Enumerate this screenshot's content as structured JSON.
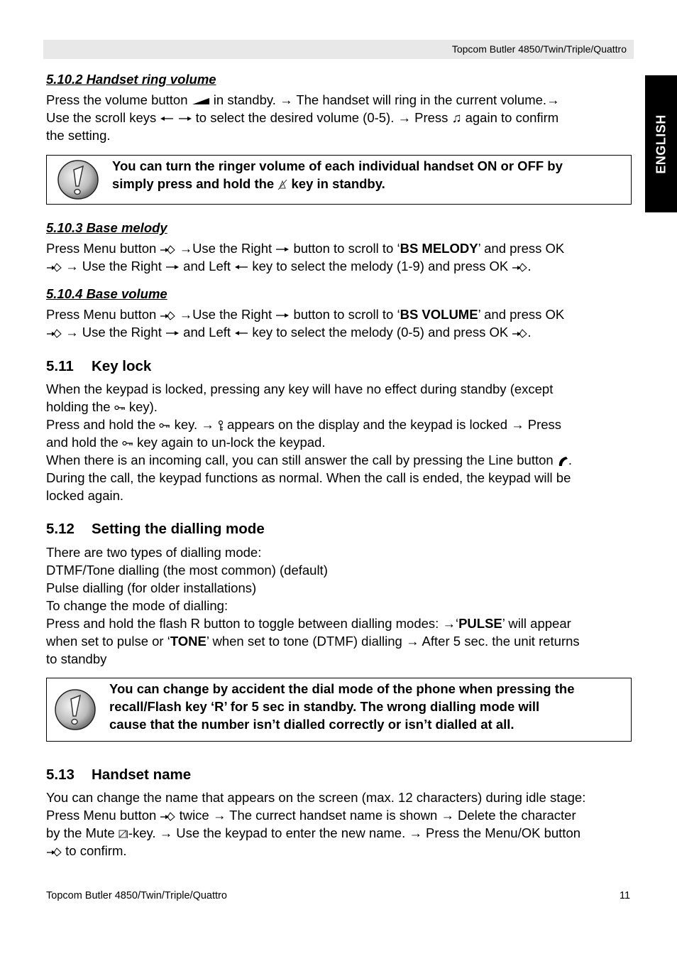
{
  "header": {
    "title": "Topcom Butler 4850/Twin/Triple/Quattro"
  },
  "language_tab": {
    "label": "ENGLISH"
  },
  "sections": {
    "ring_volume": {
      "heading": "5.10.2 Handset ring volume",
      "lines": [
        [
          "Press the volume button ",
          " in standby. ",
          "  The handset will ring in the current volume.",
          ""
        ],
        [
          "Use the scroll keys ",
          " ",
          " to select the desired volume (0-5). ",
          " Press ",
          " again to confirm"
        ],
        [
          "the setting."
        ]
      ],
      "note": {
        "line1": "You can turn the ringer volume of each individual handset ON or OFF by",
        "line2_a": "simply press and hold the ",
        "line2_b": " key in standby."
      }
    },
    "base_melody": {
      "heading": "5.10.3 Base melody",
      "l1_a": "Press Menu button ",
      "l1_b": "Use the Right ",
      "l1_c": " button to scroll to ‘",
      "l1_bold": "BS MELODY",
      "l1_d": "’ and press OK",
      "l2_a": "  Use the Right ",
      "l2_b": " and Left ",
      "l2_c": " key to select the melody (1-9) and press OK ",
      "l2_d": "."
    },
    "base_volume": {
      "heading": "5.10.4 Base volume",
      "l1_a": "Press Menu button ",
      "l1_b": "Use the Right ",
      "l1_c": " button to scroll to ‘",
      "l1_bold": "BS VOLUME",
      "l1_d": "’ and press OK",
      "l2_a": "  Use the Right ",
      "l2_b": " and Left ",
      "l2_c": " key to select the melody (0-5) and press OK ",
      "l2_d": "."
    },
    "key_lock": {
      "number": "5.11",
      "title": "Key lock",
      "l1": "When the keypad is locked, pressing any key will have no effect during standby (except",
      "l2_a": "holding the ",
      "l2_b": " key).",
      "l3_a": "Press and hold the ",
      "l3_b": " key. ",
      "l3_c": " appears on the display and the keypad is locked  ",
      "l3_d": " Press",
      "l4_a": "and hold the ",
      "l4_b": " key again to un-lock the keypad.",
      "l5_a": "When there is an incoming call, you can still answer the call by pressing the Line button ",
      "l5_b": ".",
      "l6": "During the call, the keypad functions as normal. When the call is ended, the keypad will be",
      "l7": "locked again."
    },
    "dialling_mode": {
      "number": "5.12",
      "title": "Setting the dialling mode",
      "l1": "There are two types of dialling mode:",
      "l2": "DTMF/Tone dialling (the most common) (default)",
      "l3": "Pulse dialling (for older installations)",
      "l4": "To change the mode of dialling:",
      "l5_a": "Press and hold the flash R button to toggle between dialling modes: ",
      "l5_b": "‘",
      "l5_bold": "PULSE",
      "l5_c": "’ will appear",
      "l6_a": "when set to pulse or ‘",
      "l6_bold": "TONE",
      "l6_b": "’ when set to tone (DTMF) dialling ",
      "l6_c": " After 5 sec. the unit returns",
      "l7": "to standby",
      "note": {
        "line1": "You can change by accident the dial mode of the phone when pressing the",
        "line2": "recall/Flash key ‘R’ for 5 sec in standby. The wrong dialling mode will",
        "line3": "cause that the number isn’t dialled correctly or isn’t dialled at all."
      }
    },
    "handset_name": {
      "number": "5.13",
      "title": "Handset name",
      "l1": "You can change the name that appears on the screen (max. 12 characters) during idle stage:",
      "l2_a": "Press Menu button ",
      "l2_b": " twice ",
      "l2_c": " The currect handset name is shown ",
      "l2_d": "  Delete the character",
      "l3_a": "by the Mute ",
      "l3_b": "-key. ",
      "l3_c": " Use the keypad to enter the new name. ",
      "l3_d": " Press the Menu/OK button",
      "l4": " to confirm."
    }
  },
  "glyphs": {
    "arrow": "→",
    "note": "♫"
  },
  "footer": {
    "left": "Topcom Butler 4850/Twin/Triple/Quattro",
    "page_number": "11"
  }
}
